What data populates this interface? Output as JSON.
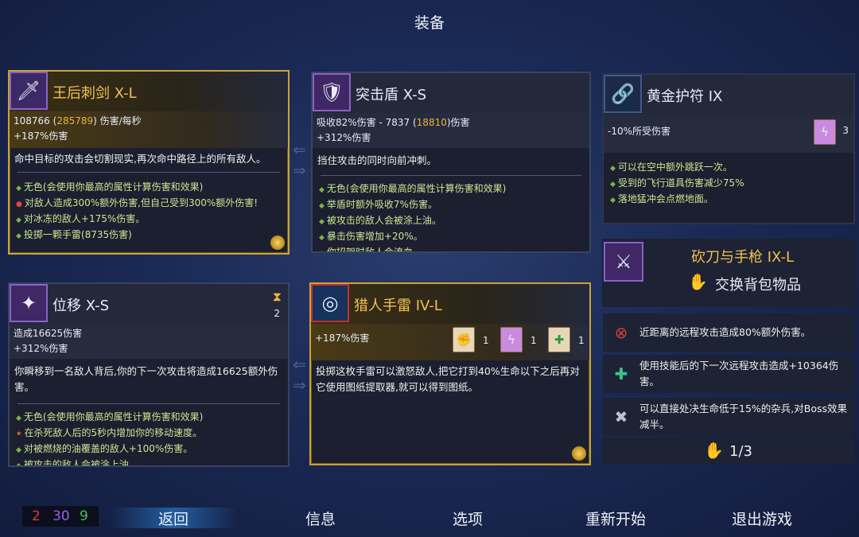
{
  "screen_title": "装备",
  "weapon1": {
    "name": "王后刺剑 X-L",
    "dmg_base": "108766",
    "dmg_crit": "285789",
    "dmg_unit": "伤害/每秒",
    "bonus": "+187%伤害",
    "description": "命中目标的攻击会切割现实,再次命中路径上的所有敌人。",
    "affixes": [
      "无色(会使用你最高的属性计算伤害和效果)",
      "对敌人造成300%额外伤害,但自己受到300%额外伤害!",
      "对冰冻的敌人+175%伤害。",
      "投掷一颗手雷(8735伤害)"
    ],
    "affix_highlight": "冰冻"
  },
  "shield": {
    "name": "突击盾 X-S",
    "stat1": "吸收82%伤害 - 7837",
    "stat1_crit": "18810",
    "stat1_unit": "伤害",
    "bonus": "+312%伤害",
    "description": "挡住攻击的同时向前冲刺。",
    "affixes": [
      "无色(会使用你最高的属性计算伤害和效果)",
      "举盾时额外吸收7%伤害。",
      "被攻击的敌人会被涂上油。",
      "暴击伤害增加+20%。",
      "你招架时敌人会流血。"
    ]
  },
  "amulet": {
    "name": "黄金护符 IX",
    "stat": "-10%所受伤害",
    "count": "3",
    "affixes": [
      "可以在空中额外跳跃一次。",
      "受到的飞行道具伤害减少75%",
      "落地猛冲会点燃地面。"
    ],
    "affix_highlight": "点燃"
  },
  "skill1": {
    "name": "位移 X-S",
    "cooldown_count": "2",
    "stat": "造成16625伤害",
    "bonus": "+312%伤害",
    "description": "你瞬移到一名敌人背后,你的下一次攻击将造成16625额外伤害。",
    "affixes": [
      "无色(会使用你最高的属性计算伤害和效果)",
      "在杀死敌人后的5秒内增加你的移动速度。",
      "对被燃烧的油覆盖的敌人+100%伤害。",
      "被攻击的敌人会被涂上油。"
    ]
  },
  "skill2": {
    "name": "猎人手雷 IV-L",
    "bonus": "+187%伤害",
    "scroll_counts": [
      "1",
      "1",
      "1"
    ],
    "description": "投掷这枚手雷可以激怒敌人,把它打到40%生命以下之后再对它使用图纸提取器,就可以得到图纸。"
  },
  "backpack": {
    "name": "砍刀与手枪 IX-L",
    "swap_label": "交换背包物品"
  },
  "mutations": {
    "items": [
      "近距离的远程攻击造成80%额外伤害。",
      "使用技能后的下一次远程攻击造成+10364伤害。",
      "可以直接处决生命低于15%的杂兵,对Boss效果减半。"
    ],
    "count": "1/3"
  },
  "scroll_counter": {
    "red": "2",
    "purple": "30",
    "green": "9"
  },
  "menu": {
    "back": "返回",
    "info": "信息",
    "options": "选项",
    "restart": "重新开始",
    "quit": "退出游戏"
  },
  "colors": {
    "gold": "#c9a337",
    "brutality": "#e03a3a",
    "tactics": "#9b5cf0",
    "survival": "#3fc45a",
    "affix_text": "#cbe68f"
  }
}
